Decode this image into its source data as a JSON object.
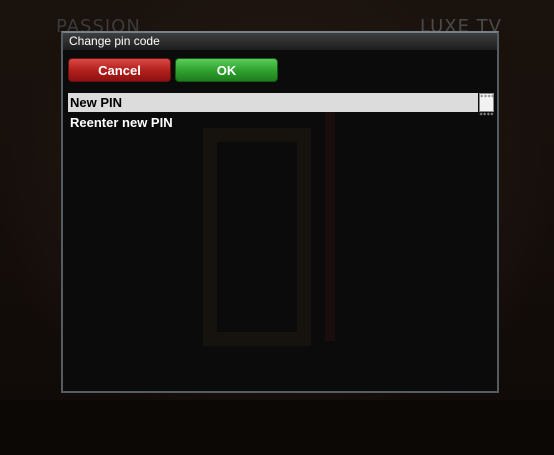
{
  "background": {
    "channel_left": "PASSION",
    "channel_right": "LUXE TV"
  },
  "dialog": {
    "title": "Change pin code",
    "buttons": {
      "cancel_label": "Cancel",
      "ok_label": "OK"
    },
    "fields": [
      {
        "label": "New PIN",
        "value": "****",
        "selected": true
      },
      {
        "label": "Reenter new PIN",
        "value": "****",
        "selected": false
      }
    ]
  },
  "colors": {
    "cancel": "#b3201d",
    "ok": "#2fa42f",
    "selection": "#dcdcdc"
  }
}
